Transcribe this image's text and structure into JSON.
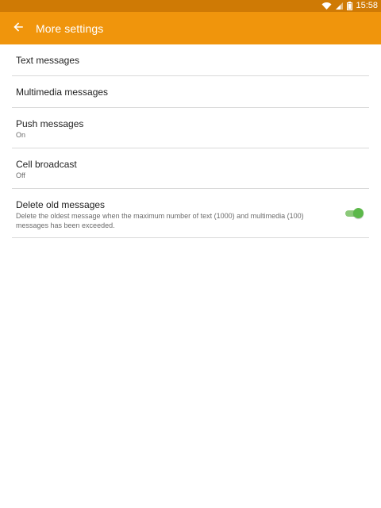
{
  "status_bar": {
    "time": "15:58",
    "icons": [
      "wifi-icon",
      "signal-icon",
      "battery-icon"
    ]
  },
  "app_bar": {
    "title": "More settings",
    "back_icon": "arrow-back-icon",
    "background": "#f0950c"
  },
  "settings": {
    "items": [
      {
        "title": "Text messages"
      },
      {
        "title": "Multimedia messages"
      },
      {
        "title": "Push messages",
        "subtitle": "On"
      },
      {
        "title": "Cell broadcast",
        "subtitle": "Off"
      },
      {
        "title": "Delete old messages",
        "description": "Delete the oldest message when the maximum number of text (1000) and multimedia (100) messages has been exceeded.",
        "toggle_on": true
      }
    ]
  },
  "colors": {
    "accent": "#f0950c",
    "status_bar": "#cf7a05",
    "toggle_on": "#5cb84a"
  }
}
